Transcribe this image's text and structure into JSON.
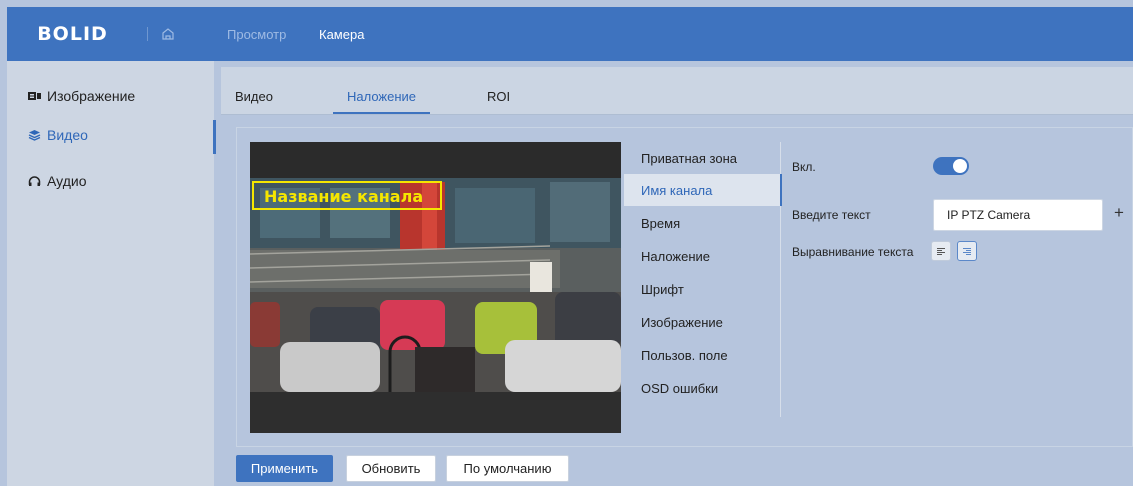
{
  "header": {
    "logo": "BOLID",
    "nav": [
      {
        "label": "Просмотр"
      },
      {
        "label": "Камера"
      }
    ]
  },
  "sidebar": {
    "items": [
      {
        "label": "Изображение",
        "icon": "camera-icon"
      },
      {
        "label": "Видео",
        "icon": "layers-icon"
      },
      {
        "label": "Аудио",
        "icon": "headphones-icon"
      }
    ]
  },
  "tabs": [
    {
      "label": "Видео"
    },
    {
      "label": "Наложение"
    },
    {
      "label": "ROI"
    }
  ],
  "preview": {
    "overlay_text": "Название канала"
  },
  "submenu": {
    "items": [
      {
        "label": "Приватная зона"
      },
      {
        "label": "Имя канала"
      },
      {
        "label": "Время"
      },
      {
        "label": "Наложение"
      },
      {
        "label": "Шрифт"
      },
      {
        "label": "Изображение"
      },
      {
        "label": "Пользов. поле"
      },
      {
        "label": "OSD ошибки"
      }
    ]
  },
  "form": {
    "enable_label": "Вкл.",
    "enable_value": true,
    "text_label": "Введите текст",
    "text_value": "IP PTZ Camera",
    "align_label": "Выравнивание текста"
  },
  "buttons": {
    "apply": "Применить",
    "refresh": "Обновить",
    "default": "По умолчанию"
  },
  "colors": {
    "accent": "#3e73bf",
    "overlay_text": "#f5e600"
  }
}
